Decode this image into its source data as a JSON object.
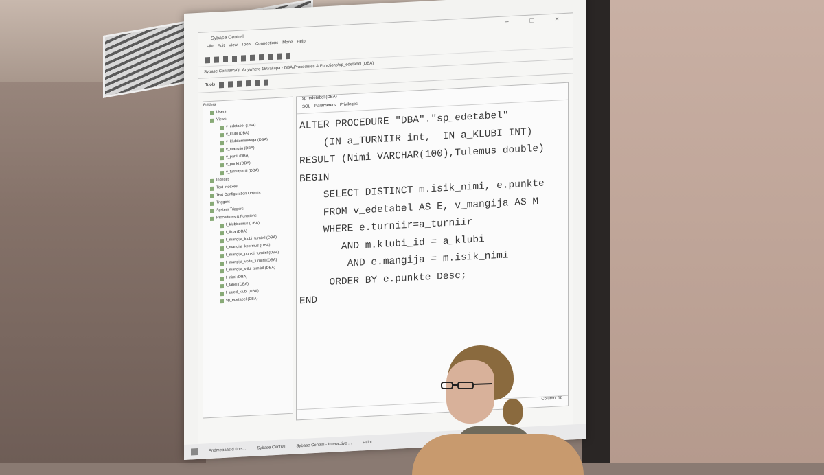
{
  "window": {
    "title": "Sybase Central",
    "controls": [
      "–",
      "□",
      "×"
    ]
  },
  "menu": [
    "File",
    "Edit",
    "View",
    "Tools",
    "Connections",
    "Mode",
    "Help"
  ],
  "path": "Sybase Central\\SQL Anywhere 16\\valjapa - DBA\\Procedures & Functions\\sp_edetabel (DBA)",
  "toolbar2_label": "Tools",
  "folders_label": "Folders",
  "tree": [
    "Users",
    "Views",
    "v_edetabel (DBA)",
    "v_klubi (DBA)",
    "v_klubiturniiridega (DBA)",
    "v_mangija (DBA)",
    "v_partii (DBA)",
    "v_punkt (DBA)",
    "v_turniirpartii (DBA)",
    "Indexes",
    "Text Indexes",
    "Text Configuration Objects",
    "Triggers",
    "System Triggers",
    "Procedures & Functions",
    "f_klubisuurus (DBA)",
    "f_liida (DBA)",
    "f_mangija_klubi_turniiril (DBA)",
    "f_mangija_koormus (DBA)",
    "f_mangija_punkti_turniiril (DBA)",
    "f_mangija_voite_turniiril (DBA)",
    "f_mangija_viiki_turniiril (DBA)",
    "f_nimi (DBA)",
    "f_tabel (DBA)",
    "f_uued_klubi (DBA)",
    "sp_edetabel (DBA)"
  ],
  "doc_tab": "sp_edetabel (DBA)",
  "subtabs": [
    "SQL",
    "Parameters",
    "Privileges"
  ],
  "code_lines": [
    "ALTER PROCEDURE \"DBA\".\"sp_edetabel\"",
    "    (IN a_TURNIIR int,  IN a_KLUBI INT)",
    "RESULT (Nimi VARCHAR(100),Tulemus double)",
    "BEGIN",
    "    SELECT DISTINCT m.isik_nimi, e.punkte",
    "    FROM v_edetabel AS E, v_mangija AS M",
    "    WHERE e.turniir=a_turniir",
    "       AND m.klubi_id = a_klubi",
    "        AND e.mangija = m.isik_nimi",
    "     ORDER BY e.punkte Desc;",
    "END"
  ],
  "status": "Column: 16",
  "taskbar": [
    "Andmebaasid ühis...",
    "Sybase Central",
    "Sybase Central - Interactive ...",
    "Paint"
  ]
}
